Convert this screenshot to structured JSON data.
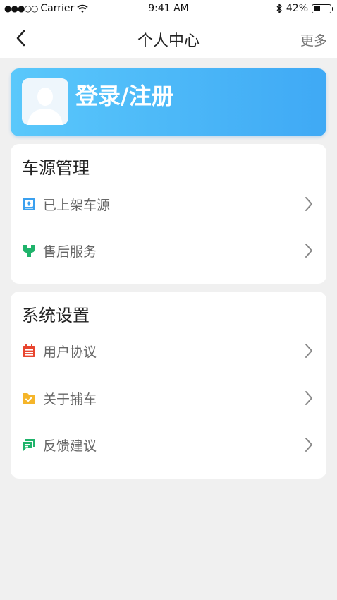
{
  "status_bar": {
    "signal": "●●●○○",
    "carrier": "Carrier",
    "time": "9:41 AM",
    "battery": "42%",
    "battery_level": 0.42
  },
  "nav": {
    "title": "个人中心",
    "more": "更多"
  },
  "login": {
    "label": "登录/注册"
  },
  "vehicle_section": {
    "title": "车源管理",
    "items": [
      {
        "label": "已上架车源",
        "icon": "listed-vehicles-icon",
        "color": "#3aa0ef"
      },
      {
        "label": "售后服务",
        "icon": "wrench-icon",
        "color": "#1fb36b"
      }
    ]
  },
  "settings_section": {
    "title": "系统设置",
    "items": [
      {
        "label": "用户协议",
        "icon": "calendar-icon",
        "color": "#e8452f"
      },
      {
        "label": "关于捕车",
        "icon": "folder-check-icon",
        "color": "#f5b52a"
      },
      {
        "label": "反馈建议",
        "icon": "chat-icon",
        "color": "#1fb36b"
      }
    ]
  }
}
